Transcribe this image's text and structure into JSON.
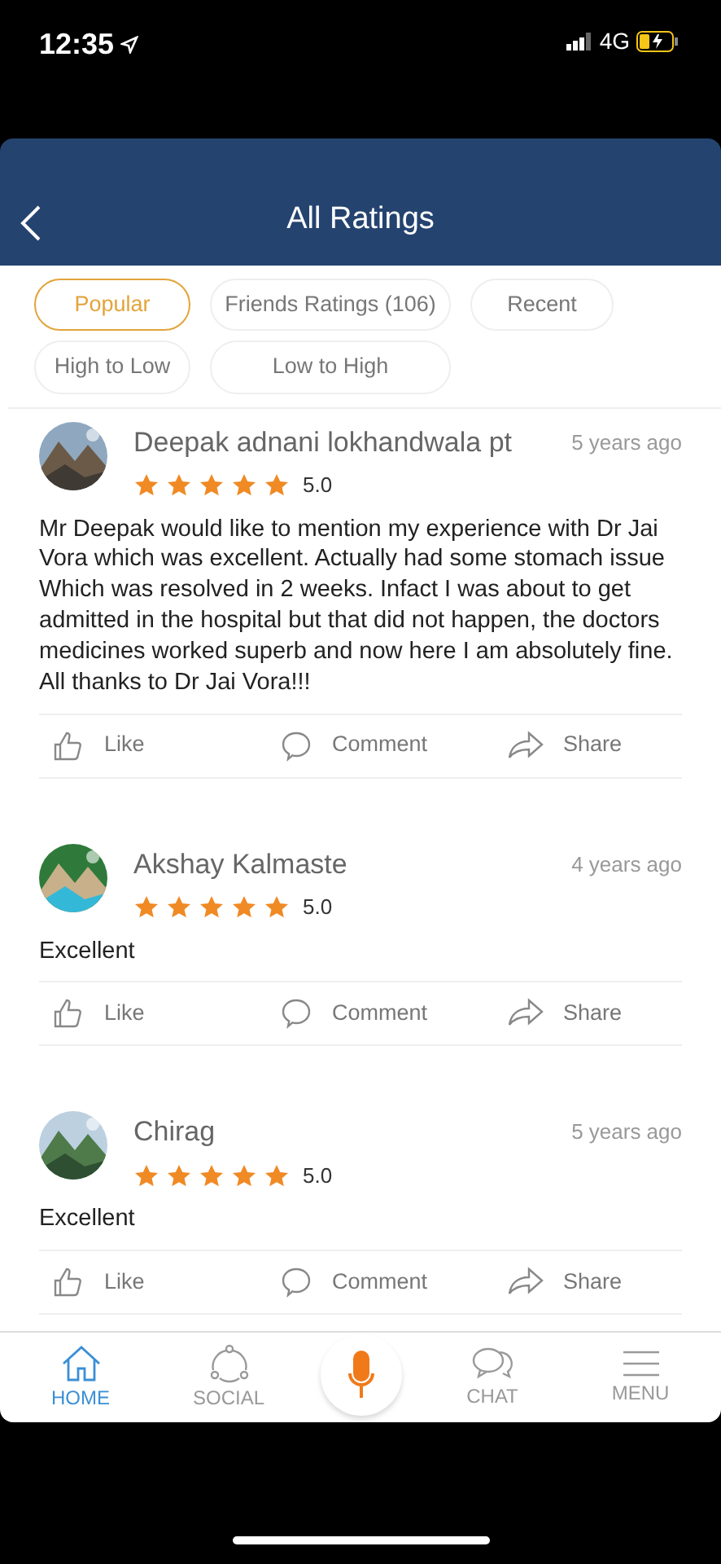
{
  "status_bar": {
    "time": "12:35",
    "network": "4G"
  },
  "header": {
    "title": "All Ratings"
  },
  "filters": [
    {
      "label": "Popular",
      "selected": true
    },
    {
      "label": "Friends Ratings (106)",
      "selected": false
    },
    {
      "label": "Recent",
      "selected": false
    },
    {
      "label": "High to Low",
      "selected": false
    },
    {
      "label": "Low to High",
      "selected": false
    }
  ],
  "reviews": [
    {
      "name": "Deepak adnani lokhandwala pt",
      "time": "5 years ago",
      "stars": 5,
      "score": "5.0",
      "text": "Mr Deepak would like to mention my experience with Dr Jai Vora which was excellent. Actually had some stomach issue Which was resolved in 2 weeks. Infact I was about to get admitted in the hospital but that did not happen, the doctors medicines worked superb and now here I am  absolutely fine. All thanks to Dr Jai Vora!!!",
      "actions": [
        "Like",
        "Comment",
        "Share"
      ]
    },
    {
      "name": "Akshay Kalmaste",
      "time": "4 years ago",
      "stars": 5,
      "score": "5.0",
      "text": "Excellent",
      "actions": [
        "Like",
        "Comment",
        "Share"
      ]
    },
    {
      "name": "Chirag",
      "time": "5 years ago",
      "stars": 5,
      "score": "5.0",
      "text": "Excellent",
      "actions": [
        "Like",
        "Comment",
        "Share"
      ]
    }
  ],
  "bottom_nav": [
    {
      "kind": "home",
      "label": "HOME",
      "selected": true
    },
    {
      "kind": "social",
      "label": "SOCIAL",
      "selected": false
    },
    {
      "kind": "mic",
      "selected": false
    },
    {
      "kind": "chat",
      "label": "CHAT",
      "selected": false
    },
    {
      "kind": "menu",
      "label": "MENU",
      "selected": false
    }
  ]
}
